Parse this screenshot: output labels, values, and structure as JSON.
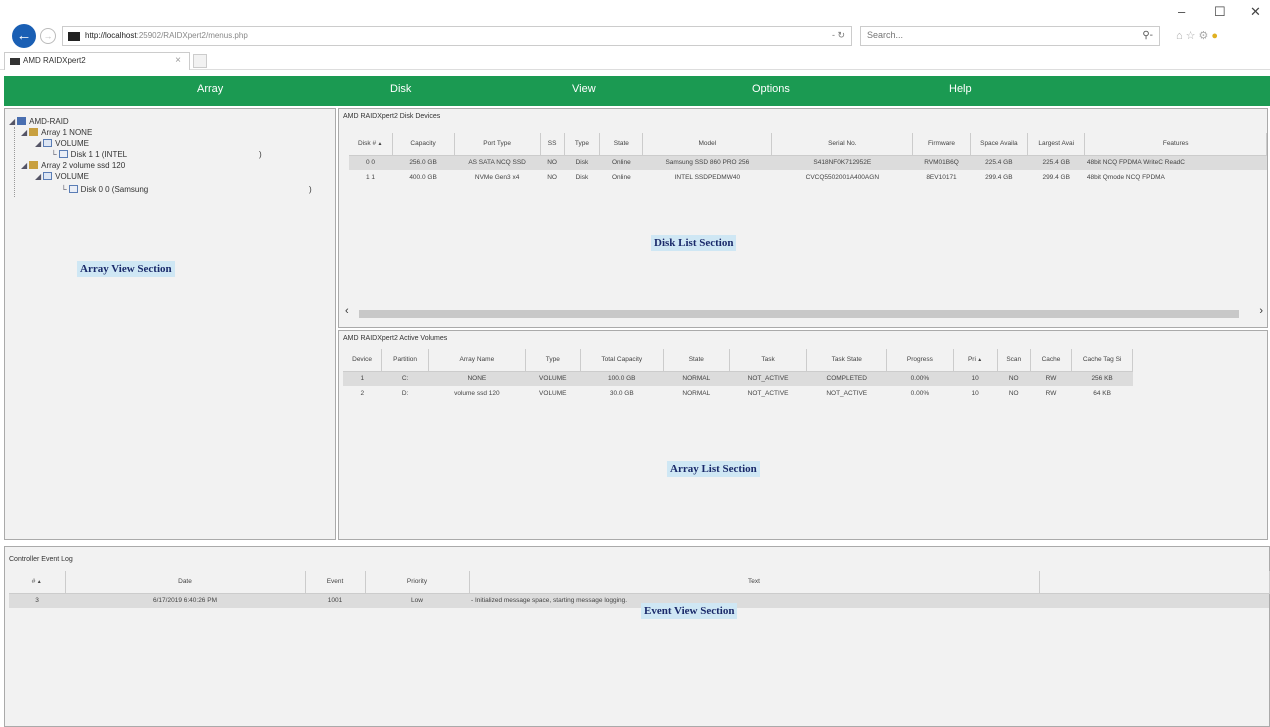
{
  "browser": {
    "url_host": "http://localhost",
    "url_rest": ":25902/RAIDXpert2/menus.php",
    "search_placeholder": "Search...",
    "tab_title": "AMD RAIDXpert2",
    "minimize": "–",
    "maximize": "☐",
    "close": "✕"
  },
  "menu": [
    "Array",
    "Disk",
    "View",
    "Options",
    "Help"
  ],
  "array_view": {
    "label": "Array View Section",
    "tree": {
      "root": "AMD-RAID",
      "array1": "Array 1 NONE",
      "volume1": "VOLUME",
      "disk1": "Disk 1 1 (INTEL",
      "array2": "Array 2 volume ssd 120",
      "volume2": "VOLUME",
      "disk2": "Disk 0 0 (Samsung"
    },
    "trailing_marks": [
      ")",
      ")"
    ]
  },
  "disk_list": {
    "title": "AMD RAIDXpert2 Disk Devices",
    "label": "Disk List Section",
    "columns": [
      "Disk #",
      "Capacity",
      "Port Type",
      "SS",
      "Type",
      "State",
      "Model",
      "Serial No.",
      "Firmware",
      "Space Availa",
      "Largest Avai",
      "Features"
    ],
    "rows": [
      [
        "0 0",
        "256.0 GB",
        "AS SATA NCQ SSD",
        "NO",
        "Disk",
        "Online",
        "Samsung SSD 860 PRO 256",
        "S418NF0K712952E",
        "RVM01B6Q",
        "225.4 GB",
        "225.4 GB",
        "48bit NCQ FPDMA WriteC ReadC"
      ],
      [
        "1 1",
        "400.0 GB",
        "NVMe Gen3 x4",
        "NO",
        "Disk",
        "Online",
        "INTEL SSDPEDMW40",
        "CVCQ5502001A400AGN",
        "8EV10171",
        "299.4 GB",
        "299.4 GB",
        "48bit Qmode NCQ FPDMA"
      ]
    ]
  },
  "array_list": {
    "title": "AMD RAIDXpert2 Active Volumes",
    "label": "Array List Section",
    "columns": [
      "Device",
      "Partition",
      "Array Name",
      "Type",
      "Total Capacity",
      "State",
      "Task",
      "Task State",
      "Progress",
      "Pri",
      "Scan",
      "Cache",
      "Cache Tag Si"
    ],
    "rows": [
      [
        "1",
        "C:",
        "NONE",
        "VOLUME",
        "100.0 GB",
        "NORMAL",
        "NOT_ACTIVE",
        "COMPLETED",
        "0.00%",
        "10",
        "NO",
        "RW",
        "256 KB"
      ],
      [
        "2",
        "D:",
        "volume ssd 120",
        "VOLUME",
        "30.0 GB",
        "NORMAL",
        "NOT_ACTIVE",
        "NOT_ACTIVE",
        "0.00%",
        "10",
        "NO",
        "RW",
        "64 KB"
      ]
    ]
  },
  "event_view": {
    "title": "Controller Event Log",
    "label": "Event View Section",
    "columns": [
      "#",
      "Date",
      "Event",
      "Priority",
      "Text"
    ],
    "rows": [
      [
        "3",
        "6/17/2019 6:40:26 PM",
        "1001",
        "Low",
        "- Initialized message space, starting message logging."
      ]
    ]
  }
}
